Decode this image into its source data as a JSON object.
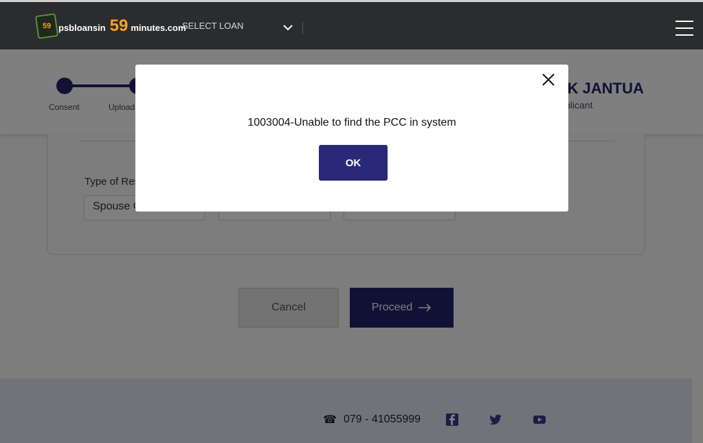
{
  "header": {
    "logo_badge": "59",
    "logo_prefix": "psbloansin",
    "logo_number": "59",
    "logo_suffix": "minutes.com",
    "select_loan": "SELECT LOAN"
  },
  "stepper": {
    "steps": [
      {
        "label": "Consent"
      },
      {
        "label": "Upload"
      }
    ]
  },
  "applicant": {
    "name": "ARAK JANTUA",
    "role": "plicant"
  },
  "form": {
    "field_label": "Type of Res",
    "field_value": "Spouse C"
  },
  "actions": {
    "cancel_label": "Cancel",
    "proceed_label": "Proceed"
  },
  "footer": {
    "phone": "079 - 41055999"
  },
  "modal": {
    "message": "1003004-Unable to find the PCC in system",
    "ok_label": "OK"
  },
  "colors": {
    "brand_dark": "#23206b",
    "header_bg": "#2b2c2d",
    "accent_orange": "#f6a623"
  }
}
